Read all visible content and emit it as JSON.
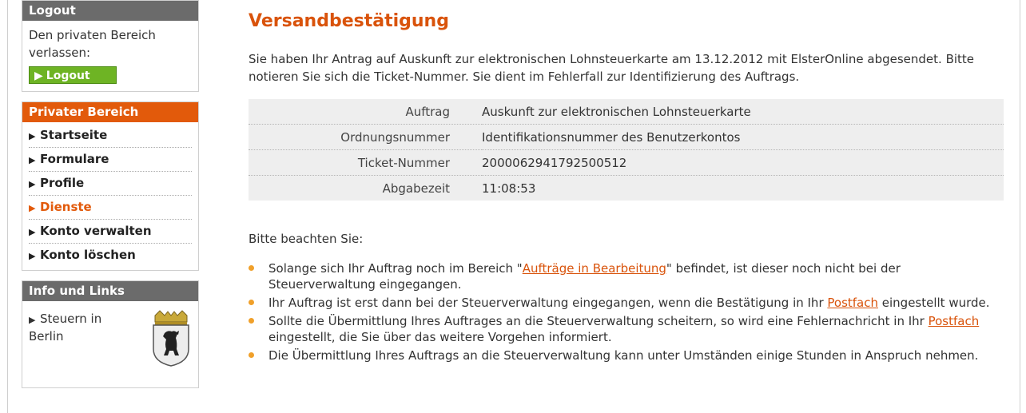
{
  "sidebar": {
    "logout": {
      "header": "Logout",
      "text": "Den privaten Bereich verlassen:",
      "button_label": "Logout"
    },
    "private": {
      "header": "Privater Bereich",
      "items": [
        {
          "label": "Startseite"
        },
        {
          "label": "Formulare"
        },
        {
          "label": "Profile"
        },
        {
          "label": "Dienste"
        },
        {
          "label": "Konto verwalten"
        },
        {
          "label": "Konto löschen"
        }
      ],
      "active": "Dienste"
    },
    "info": {
      "header": "Info und Links",
      "link_label": "Steuern in Berlin",
      "crest_icon": "berlin-crest-icon"
    }
  },
  "main": {
    "title": "Versandbestätigung",
    "intro": "Sie haben Ihr Antrag auf Auskunft zur elektronischen Lohnsteuerkarte am 13.12.2012 mit ElsterOnline abgesendet. Bitte notieren Sie sich die Ticket-Nummer. Sie dient im Fehlerfall zur Identifizierung des Auftrags.",
    "details": [
      {
        "key": "Auftrag",
        "value": "Auskunft zur elektronischen Lohnsteuerkarte"
      },
      {
        "key": "Ordnungsnummer",
        "value": "Identifikationsnummer des Benutzerkontos"
      },
      {
        "key": "Ticket-Nummer",
        "value": "2000062941792500512"
      },
      {
        "key": "Abgabezeit",
        "value": "11:08:53"
      }
    ],
    "notes_header": "Bitte beachten Sie:",
    "notes": {
      "n1_pre": "Solange sich Ihr Auftrag noch im Bereich \"",
      "n1_link": "Aufträge in Bearbeitung",
      "n1_post": "\" befindet, ist dieser noch nicht bei der Steuerverwaltung eingegangen.",
      "n2_pre": "Ihr Auftrag ist erst dann bei der Steuerverwaltung eingegangen, wenn die Bestätigung in Ihr ",
      "n2_link": "Postfach",
      "n2_post": " eingestellt wurde.",
      "n3_pre": "Sollte die Übermittlung Ihres Auftrages an die Steuerverwaltung scheitern, so wird eine Fehlernachricht in Ihr ",
      "n3_link": "Postfach",
      "n3_post": " eingestellt, die Sie über das weitere Vorgehen informiert.",
      "n4": "Die Übermittlung Ihres Auftrags an die Steuerverwaltung kann unter Umständen einige Stunden in Anspruch nehmen."
    }
  },
  "colors": {
    "accent_orange": "#e25a0b",
    "header_gray": "#6b6b6b",
    "button_green": "#6eb424",
    "bullet": "#f0a02a"
  }
}
